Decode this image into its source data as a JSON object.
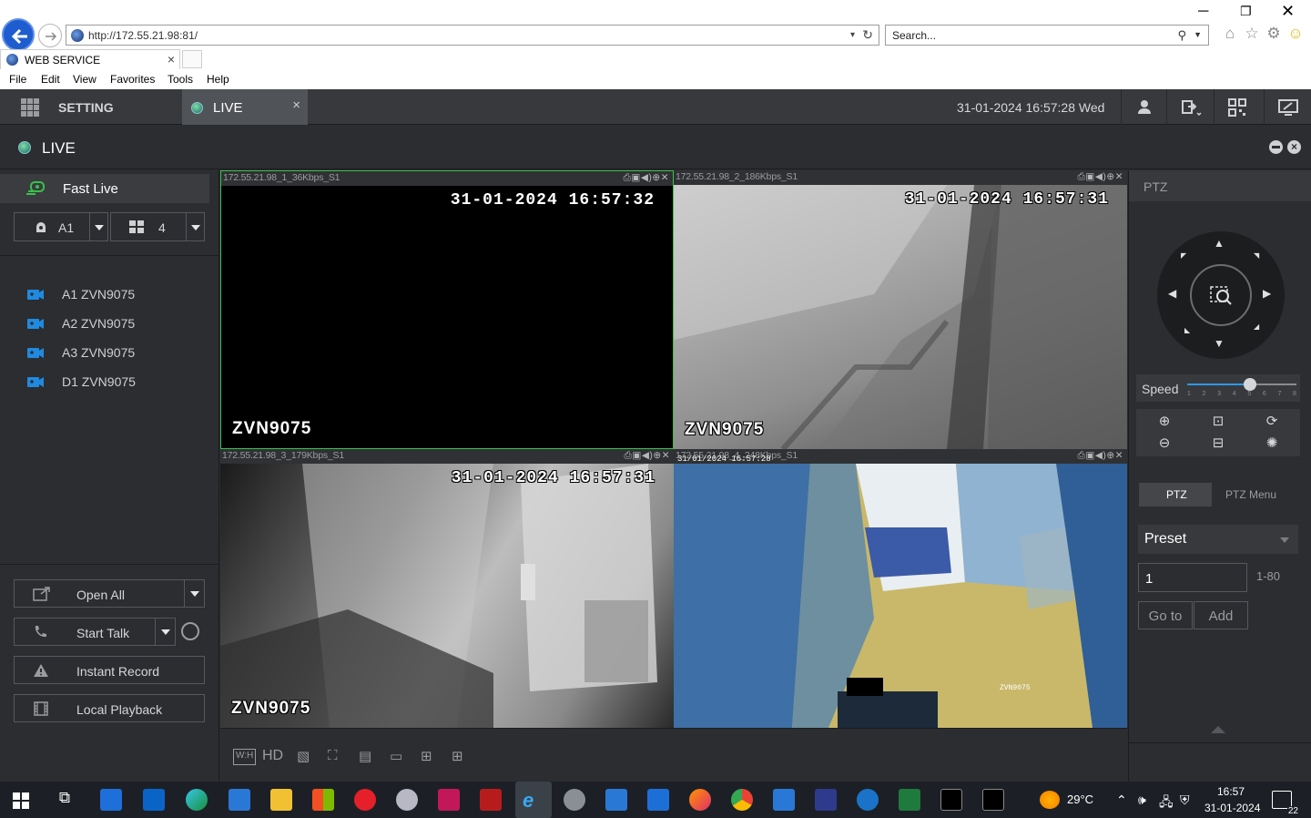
{
  "browser": {
    "url": "http://172.55.21.98:81/",
    "search_placeholder": "Search...",
    "tab_title": "WEB SERVICE",
    "menu": [
      "File",
      "Edit",
      "View",
      "Favorites",
      "Tools",
      "Help"
    ]
  },
  "app": {
    "nav": {
      "setting_label": "SETTING",
      "live_label": "LIVE",
      "datetime": "31-01-2024 16:57:28 Wed"
    },
    "page_title": "LIVE",
    "left": {
      "fast_live": "Fast Live",
      "channel_select": "A1",
      "split_select": "4",
      "cameras": [
        "A1 ZVN9075",
        "A2 ZVN9075",
        "A3 ZVN9075",
        "D1 ZVN9075"
      ],
      "buttons": {
        "open_all": "Open All",
        "start_talk": "Start Talk",
        "instant_record": "Instant Record",
        "local_playback": "Local Playback"
      }
    },
    "tiles": [
      {
        "header": "172.55.21.98_1_36Kbps_S1",
        "osd": "31-01-2024 16:57:32",
        "name": "ZVN9075"
      },
      {
        "header": "172.55.21.98_2_186Kbps_S1",
        "osd": "31-01-2024 16:57:31",
        "name": "ZVN9075"
      },
      {
        "header": "172.55.21.98_3_179Kbps_S1",
        "osd": "31-01-2024 16:57:31",
        "name": "ZVN9075"
      },
      {
        "header": "172.55.21.98_4_248Kbps_S1",
        "osd": "31/01/2024 16:57:28",
        "name": "ZVN9075"
      }
    ],
    "toolbar": {
      "hd_label": "HD",
      "wh_label": "W:H"
    },
    "ptz": {
      "header": "PTZ",
      "speed_label": "Speed",
      "speed_value": 5,
      "speed_ticks": [
        "1",
        "2",
        "3",
        "4",
        "5",
        "6",
        "7",
        "8"
      ],
      "tab_ptz": "PTZ",
      "tab_ptz_menu": "PTZ Menu",
      "preset_select": "Preset",
      "preset_value": "1",
      "preset_range": "1-80",
      "goto_label": "Go to",
      "add_label": "Add"
    }
  },
  "taskbar": {
    "temperature": "29°C",
    "time": "16:57",
    "date": "31-01-2024",
    "notifications": "22"
  },
  "colors": {
    "accent_green": "#39c04b",
    "app_bg": "#2b2d30",
    "slider_blue": "#2f98e6"
  }
}
